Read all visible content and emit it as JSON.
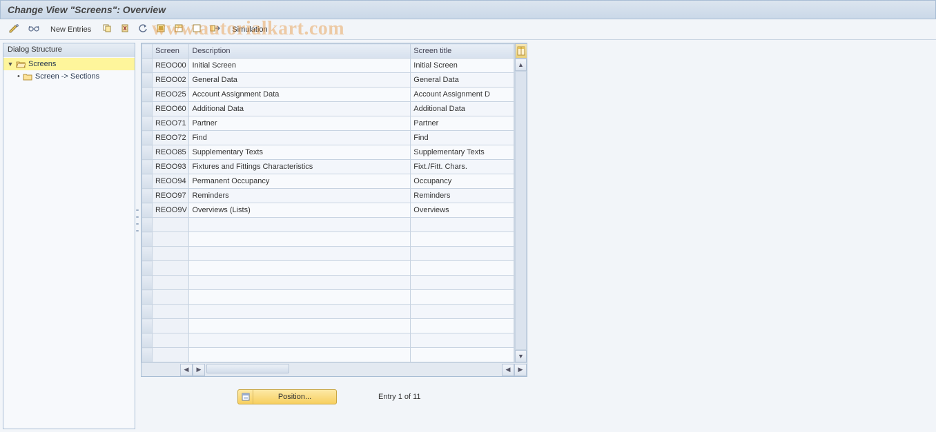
{
  "title": "Change View \"Screens\": Overview",
  "toolbar": {
    "new_entries": "New Entries",
    "simulation": "Simulation"
  },
  "sidebar": {
    "header": "Dialog Structure",
    "root": "Screens",
    "child": "Screen -> Sections"
  },
  "table": {
    "headers": {
      "screen": "Screen",
      "description": "Description",
      "screen_title": "Screen title"
    },
    "rows": [
      {
        "screen": "REOO00",
        "description": "Initial Screen",
        "title": "Initial Screen"
      },
      {
        "screen": "REOO02",
        "description": "General Data",
        "title": "General Data"
      },
      {
        "screen": "REOO25",
        "description": "Account Assignment Data",
        "title": "Account Assignment D"
      },
      {
        "screen": "REOO60",
        "description": "Additional Data",
        "title": "Additional Data"
      },
      {
        "screen": "REOO71",
        "description": "Partner",
        "title": "Partner"
      },
      {
        "screen": "REOO72",
        "description": "Find",
        "title": "Find"
      },
      {
        "screen": "REOO85",
        "description": "Supplementary Texts",
        "title": "Supplementary Texts"
      },
      {
        "screen": "REOO93",
        "description": "Fixtures and Fittings Characteristics",
        "title": "Fixt./Fitt. Chars."
      },
      {
        "screen": "REOO94",
        "description": "Permanent Occupancy",
        "title": "Occupancy"
      },
      {
        "screen": "REOO97",
        "description": "Reminders",
        "title": "Reminders"
      },
      {
        "screen": "REOO9V",
        "description": "Overviews (Lists)",
        "title": "Overviews"
      }
    ],
    "empty_rows": 10
  },
  "footer": {
    "position_label": "Position...",
    "entry_text": "Entry 1 of 11"
  },
  "watermark": "www.autorialkart.com"
}
